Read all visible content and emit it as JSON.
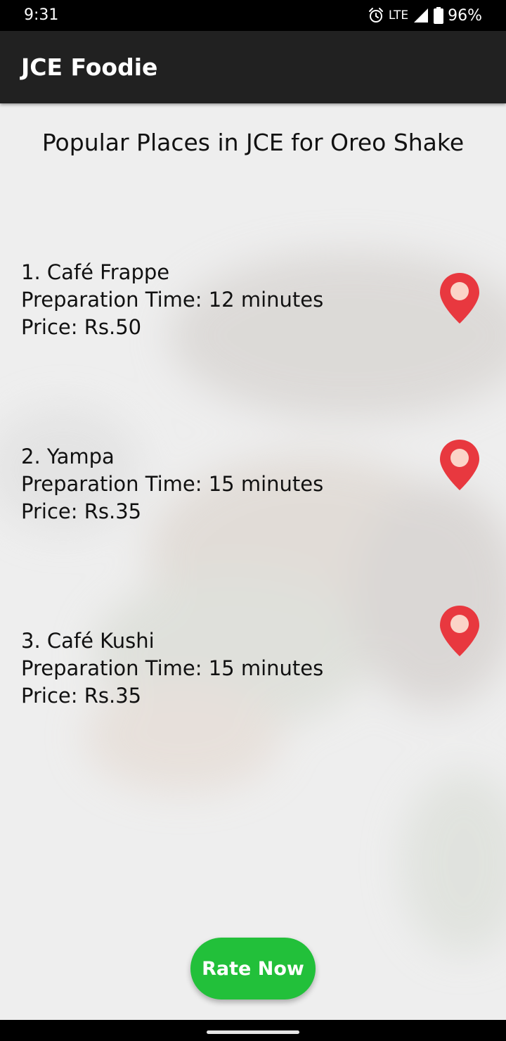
{
  "status_bar": {
    "time": "9:31",
    "network": "LTE",
    "battery": "96%",
    "icons": [
      "alarm-icon",
      "signal-icon",
      "battery-icon"
    ]
  },
  "app_bar": {
    "title": "JCE Foodie"
  },
  "main": {
    "heading": "Popular Places in JCE for Oreo Shake",
    "places": [
      {
        "name": "1. Café Frappe",
        "prep_time": "Preparation Time: 12 minutes",
        "price": "Price: Rs.50",
        "icon": "location-pin-icon"
      },
      {
        "name": "2. Yampa",
        "prep_time": "Preparation Time: 15 minutes",
        "price": "Price: Rs.35",
        "icon": "location-pin-icon"
      },
      {
        "name": "3. Café Kushi",
        "prep_time": "Preparation Time: 15 minutes",
        "price": "Price: Rs.35",
        "icon": "location-pin-icon"
      }
    ],
    "rate_button_label": "Rate Now"
  },
  "colors": {
    "app_bar": "#212121",
    "status_bar": "#000000",
    "pin": "#e8383f",
    "pin_center": "#fbd4c8",
    "button": "#22c03a",
    "background": "#efefef"
  }
}
